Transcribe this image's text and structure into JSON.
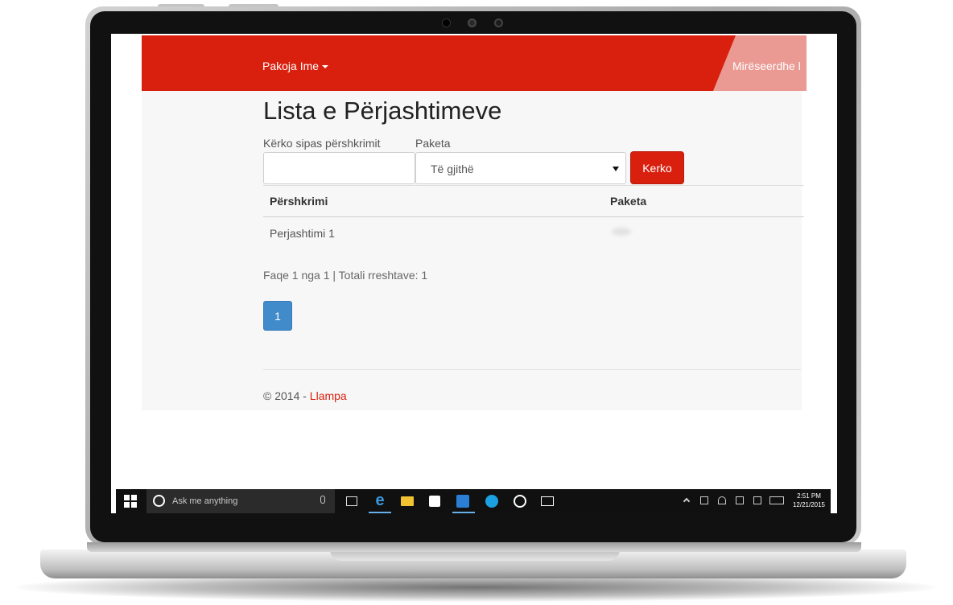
{
  "navbar": {
    "brand_label": "Pakoja Ime",
    "welcome_text": "Mirëseerdhe l"
  },
  "page": {
    "title": "Lista e Përjashtimeve",
    "search": {
      "description_label": "Kërko sipas përshkrimit",
      "description_value": "",
      "package_label": "Paketa",
      "package_selected": "Të gjithë",
      "search_button": "Kerko"
    },
    "table": {
      "headers": [
        "Përshkrimi",
        "Paketa"
      ],
      "rows": [
        {
          "description": "Perjashtimi 1",
          "package": ""
        }
      ]
    },
    "summary": "Faqe 1 nga 1 | Totali rreshtave: 1",
    "pagination": {
      "current_page": "1"
    },
    "footer": {
      "copyright": "© 2014 - ",
      "link": "Llampa"
    }
  },
  "taskbar": {
    "search_placeholder": "Ask me anything",
    "time": "2:51 PM",
    "date": "12/21/2015"
  },
  "colors": {
    "brand_red": "#d9200f",
    "pager_blue": "#428bca"
  }
}
